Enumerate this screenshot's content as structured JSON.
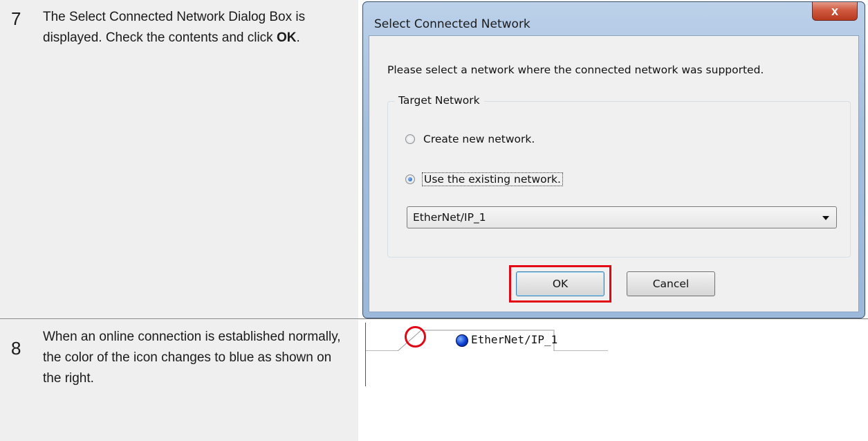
{
  "step7": {
    "number": "7",
    "text_part1": "The Select Connected Network Dialog Box is displayed. Check the contents and click ",
    "text_bold": "OK",
    "text_part2": "."
  },
  "step8": {
    "number": "8",
    "text": "When an online connection is established normally, the color of the icon changes to blue as shown on the right."
  },
  "dialog": {
    "title": "Select Connected Network",
    "close_label": "x",
    "prompt": "Please select a network where the connected network was supported.",
    "group_label": "Target Network",
    "radio_create_label": "Create new network.",
    "radio_existing_label": "Use the existing network.",
    "selected_radio": "existing",
    "network_select_value": "EtherNet/IP_1",
    "ok_label": "OK",
    "cancel_label": "Cancel"
  },
  "tab": {
    "label": "EtherNet/IP_1",
    "status_icon": "blue-online-status-icon",
    "status_color": "#0a3fd1"
  },
  "highlight_color": "#e30613"
}
